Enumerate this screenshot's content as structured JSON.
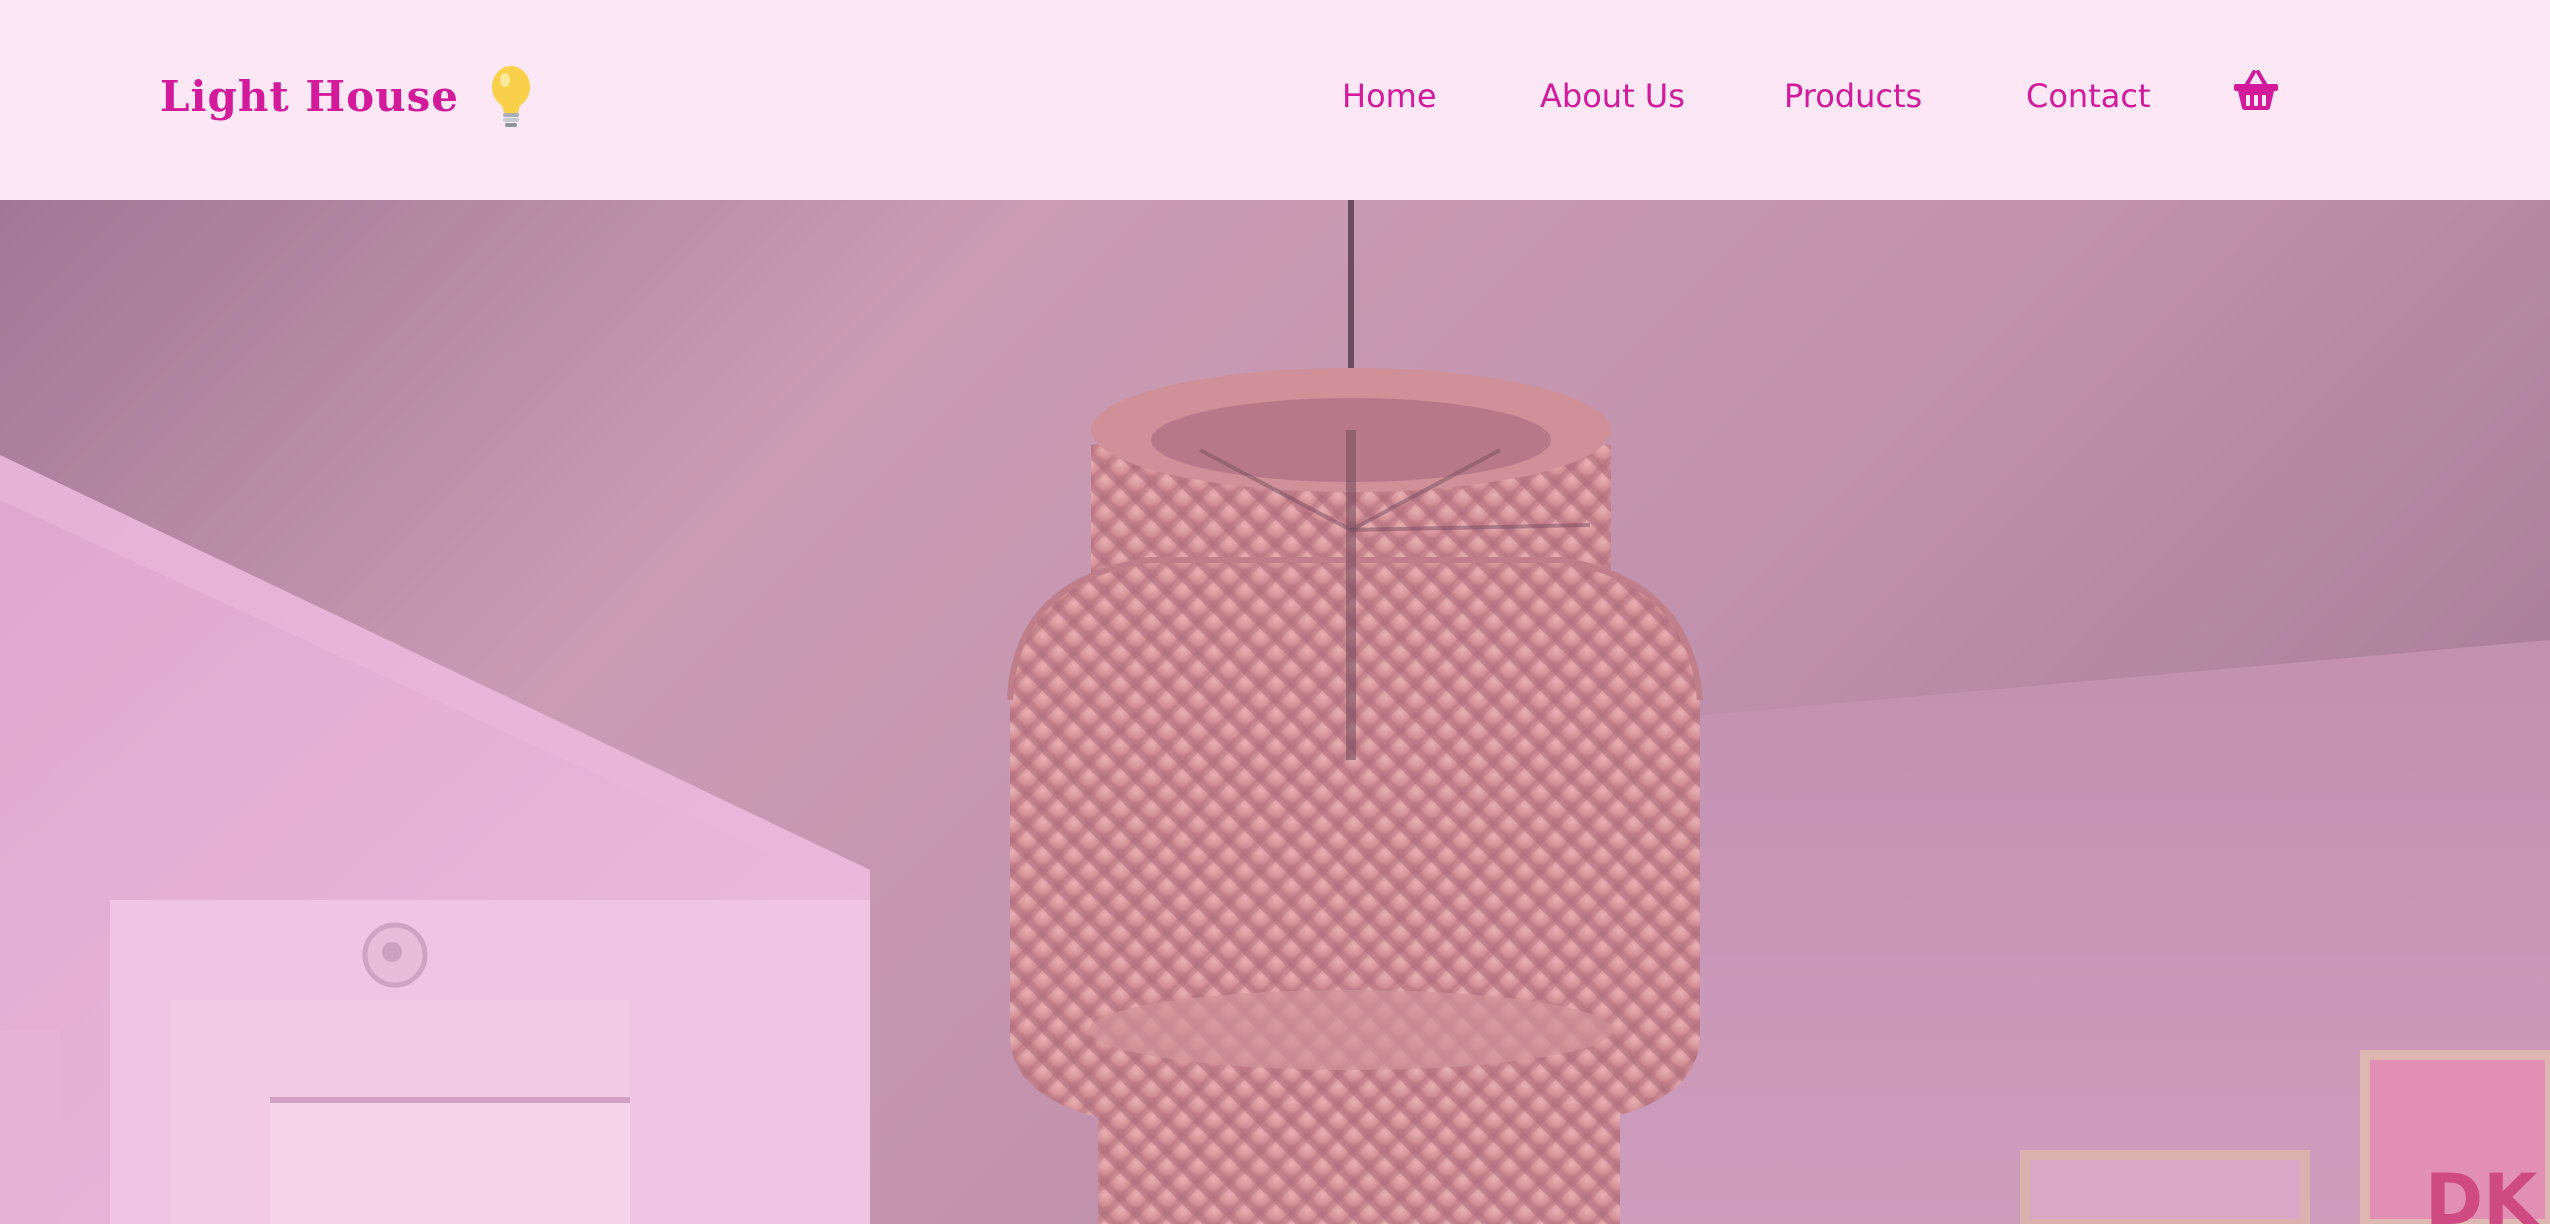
{
  "brand": {
    "name": "Light House",
    "logo_icon": "lightbulb-icon"
  },
  "nav": {
    "items": [
      {
        "label": "Home"
      },
      {
        "label": "About Us"
      },
      {
        "label": "Products"
      },
      {
        "label": "Contact"
      }
    ],
    "cart_icon": "shopping-basket-icon"
  },
  "hero": {
    "image": "woven-rattan-pendant-lamp-photo"
  },
  "colors": {
    "accent": "#d21a9b",
    "header_bg": "#fce8f5",
    "hero_tint": "#e6a4cf"
  }
}
